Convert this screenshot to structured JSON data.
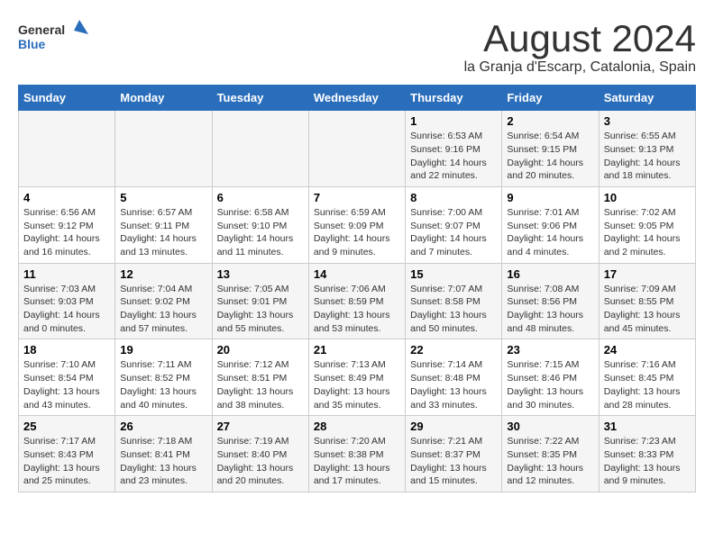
{
  "header": {
    "logo_general": "General",
    "logo_blue": "Blue",
    "month_title": "August 2024",
    "location": "la Granja d'Escarp, Catalonia, Spain"
  },
  "weekdays": [
    "Sunday",
    "Monday",
    "Tuesday",
    "Wednesday",
    "Thursday",
    "Friday",
    "Saturday"
  ],
  "weeks": [
    [
      {
        "day": "",
        "info": ""
      },
      {
        "day": "",
        "info": ""
      },
      {
        "day": "",
        "info": ""
      },
      {
        "day": "",
        "info": ""
      },
      {
        "day": "1",
        "info": "Sunrise: 6:53 AM\nSunset: 9:16 PM\nDaylight: 14 hours\nand 22 minutes."
      },
      {
        "day": "2",
        "info": "Sunrise: 6:54 AM\nSunset: 9:15 PM\nDaylight: 14 hours\nand 20 minutes."
      },
      {
        "day": "3",
        "info": "Sunrise: 6:55 AM\nSunset: 9:13 PM\nDaylight: 14 hours\nand 18 minutes."
      }
    ],
    [
      {
        "day": "4",
        "info": "Sunrise: 6:56 AM\nSunset: 9:12 PM\nDaylight: 14 hours\nand 16 minutes."
      },
      {
        "day": "5",
        "info": "Sunrise: 6:57 AM\nSunset: 9:11 PM\nDaylight: 14 hours\nand 13 minutes."
      },
      {
        "day": "6",
        "info": "Sunrise: 6:58 AM\nSunset: 9:10 PM\nDaylight: 14 hours\nand 11 minutes."
      },
      {
        "day": "7",
        "info": "Sunrise: 6:59 AM\nSunset: 9:09 PM\nDaylight: 14 hours\nand 9 minutes."
      },
      {
        "day": "8",
        "info": "Sunrise: 7:00 AM\nSunset: 9:07 PM\nDaylight: 14 hours\nand 7 minutes."
      },
      {
        "day": "9",
        "info": "Sunrise: 7:01 AM\nSunset: 9:06 PM\nDaylight: 14 hours\nand 4 minutes."
      },
      {
        "day": "10",
        "info": "Sunrise: 7:02 AM\nSunset: 9:05 PM\nDaylight: 14 hours\nand 2 minutes."
      }
    ],
    [
      {
        "day": "11",
        "info": "Sunrise: 7:03 AM\nSunset: 9:03 PM\nDaylight: 14 hours\nand 0 minutes."
      },
      {
        "day": "12",
        "info": "Sunrise: 7:04 AM\nSunset: 9:02 PM\nDaylight: 13 hours\nand 57 minutes."
      },
      {
        "day": "13",
        "info": "Sunrise: 7:05 AM\nSunset: 9:01 PM\nDaylight: 13 hours\nand 55 minutes."
      },
      {
        "day": "14",
        "info": "Sunrise: 7:06 AM\nSunset: 8:59 PM\nDaylight: 13 hours\nand 53 minutes."
      },
      {
        "day": "15",
        "info": "Sunrise: 7:07 AM\nSunset: 8:58 PM\nDaylight: 13 hours\nand 50 minutes."
      },
      {
        "day": "16",
        "info": "Sunrise: 7:08 AM\nSunset: 8:56 PM\nDaylight: 13 hours\nand 48 minutes."
      },
      {
        "day": "17",
        "info": "Sunrise: 7:09 AM\nSunset: 8:55 PM\nDaylight: 13 hours\nand 45 minutes."
      }
    ],
    [
      {
        "day": "18",
        "info": "Sunrise: 7:10 AM\nSunset: 8:54 PM\nDaylight: 13 hours\nand 43 minutes."
      },
      {
        "day": "19",
        "info": "Sunrise: 7:11 AM\nSunset: 8:52 PM\nDaylight: 13 hours\nand 40 minutes."
      },
      {
        "day": "20",
        "info": "Sunrise: 7:12 AM\nSunset: 8:51 PM\nDaylight: 13 hours\nand 38 minutes."
      },
      {
        "day": "21",
        "info": "Sunrise: 7:13 AM\nSunset: 8:49 PM\nDaylight: 13 hours\nand 35 minutes."
      },
      {
        "day": "22",
        "info": "Sunrise: 7:14 AM\nSunset: 8:48 PM\nDaylight: 13 hours\nand 33 minutes."
      },
      {
        "day": "23",
        "info": "Sunrise: 7:15 AM\nSunset: 8:46 PM\nDaylight: 13 hours\nand 30 minutes."
      },
      {
        "day": "24",
        "info": "Sunrise: 7:16 AM\nSunset: 8:45 PM\nDaylight: 13 hours\nand 28 minutes."
      }
    ],
    [
      {
        "day": "25",
        "info": "Sunrise: 7:17 AM\nSunset: 8:43 PM\nDaylight: 13 hours\nand 25 minutes."
      },
      {
        "day": "26",
        "info": "Sunrise: 7:18 AM\nSunset: 8:41 PM\nDaylight: 13 hours\nand 23 minutes."
      },
      {
        "day": "27",
        "info": "Sunrise: 7:19 AM\nSunset: 8:40 PM\nDaylight: 13 hours\nand 20 minutes."
      },
      {
        "day": "28",
        "info": "Sunrise: 7:20 AM\nSunset: 8:38 PM\nDaylight: 13 hours\nand 17 minutes."
      },
      {
        "day": "29",
        "info": "Sunrise: 7:21 AM\nSunset: 8:37 PM\nDaylight: 13 hours\nand 15 minutes."
      },
      {
        "day": "30",
        "info": "Sunrise: 7:22 AM\nSunset: 8:35 PM\nDaylight: 13 hours\nand 12 minutes."
      },
      {
        "day": "31",
        "info": "Sunrise: 7:23 AM\nSunset: 8:33 PM\nDaylight: 13 hours\nand 9 minutes."
      }
    ]
  ]
}
